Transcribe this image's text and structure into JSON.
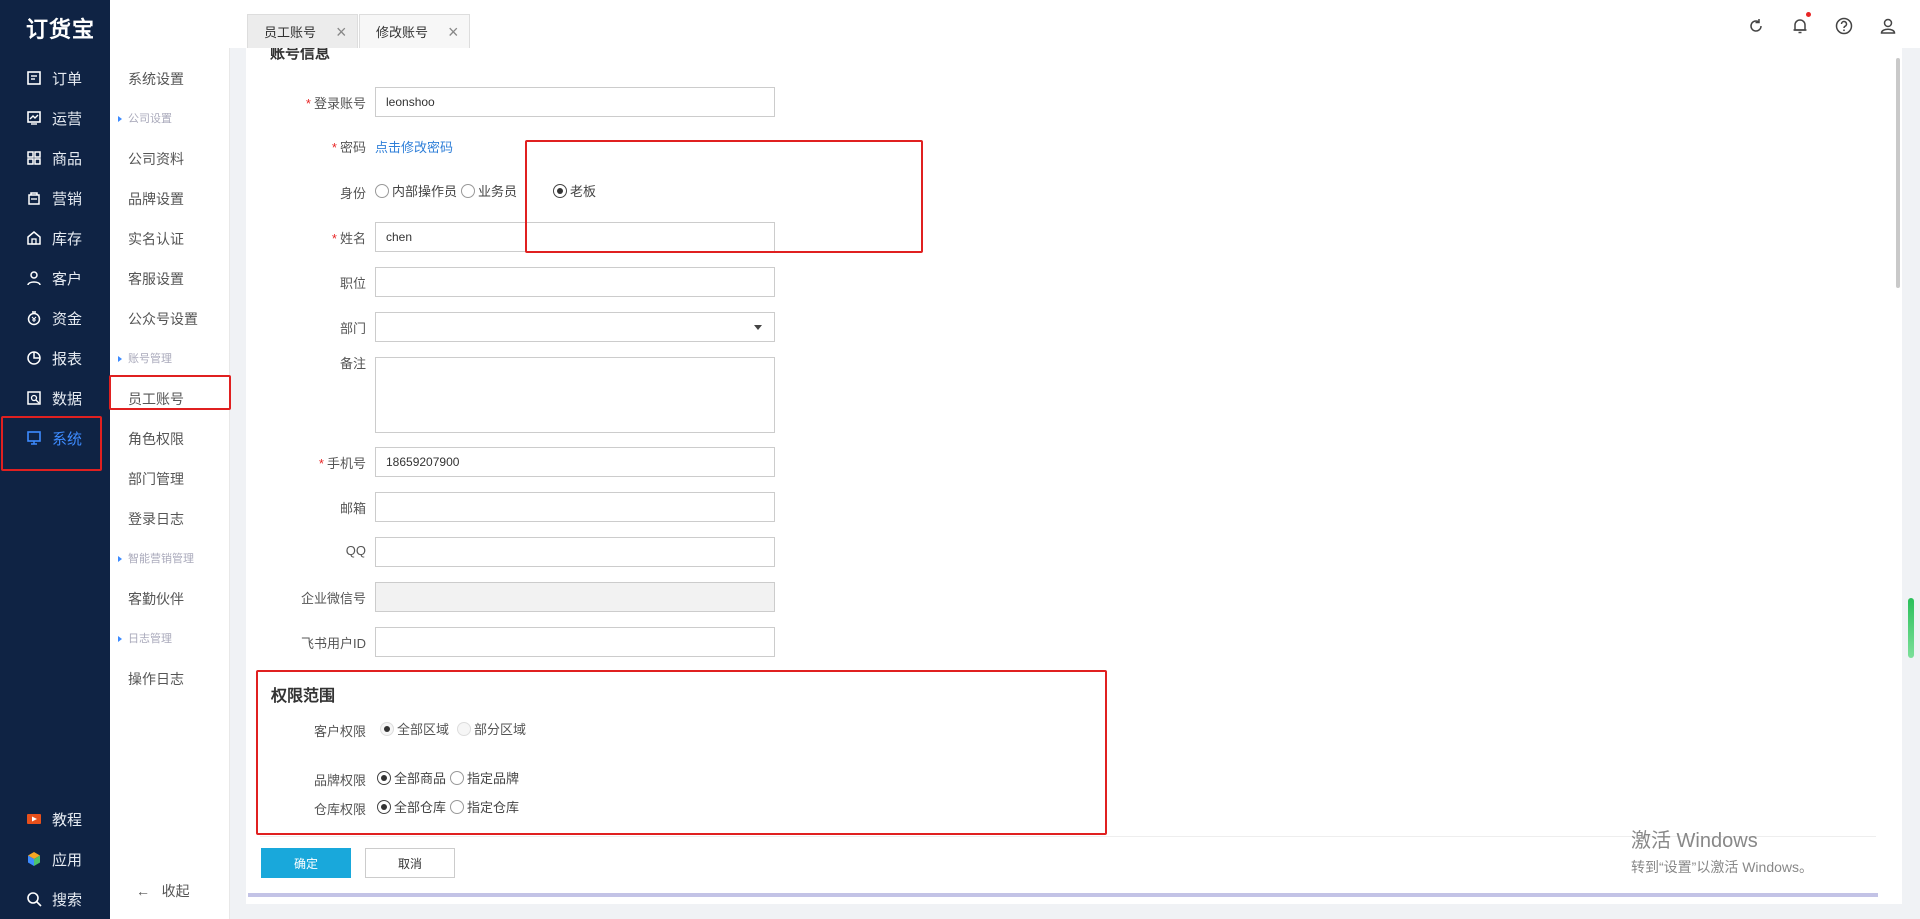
{
  "app": {
    "logo": "订货宝"
  },
  "nav": {
    "items": [
      {
        "label": "订单",
        "icon": "order-icon"
      },
      {
        "label": "运营",
        "icon": "operation-icon"
      },
      {
        "label": "商品",
        "icon": "product-icon"
      },
      {
        "label": "营销",
        "icon": "marketing-icon"
      },
      {
        "label": "库存",
        "icon": "warehouse-icon"
      },
      {
        "label": "客户",
        "icon": "customer-icon"
      },
      {
        "label": "资金",
        "icon": "money-icon"
      },
      {
        "label": "报表",
        "icon": "report-icon"
      },
      {
        "label": "数据",
        "icon": "data-icon"
      },
      {
        "label": "系统",
        "icon": "monitor-icon",
        "active": true
      }
    ],
    "bottom": [
      {
        "label": "教程",
        "icon": "tutorial-icon"
      },
      {
        "label": "应用",
        "icon": "app-icon"
      },
      {
        "label": "搜索",
        "icon": "search-icon"
      }
    ],
    "active_color": "#3d8bff",
    "background": "#0f2344"
  },
  "subnav": {
    "system_settings": "系统设置",
    "group_company": "公司设置",
    "company_info": "公司资料",
    "brand_settings": "品牌设置",
    "real_name": "实名认证",
    "customer_service": "客服设置",
    "official_account": "公众号设置",
    "group_account": "账号管理",
    "staff_account": "员工账号",
    "role_permission": "角色权限",
    "department": "部门管理",
    "login_log": "登录日志",
    "group_marketing": "智能营销管理",
    "partner": "客勤伙伴",
    "group_log": "日志管理",
    "operation_log": "操作日志",
    "collapse": "收起"
  },
  "tabs": [
    {
      "label": "员工账号"
    },
    {
      "label": "修改账号",
      "active": true
    }
  ],
  "form": {
    "section_account": "账号信息",
    "login_account_label": "登录账号",
    "login_account_value": "leonshoo",
    "password_label": "密码",
    "password_link": "点击修改密码",
    "identity_label": "身份",
    "identity_options": [
      "内部操作员",
      "业务员",
      "老板"
    ],
    "identity_selected": "老板",
    "name_label": "姓名",
    "name_value": "chen",
    "position_label": "职位",
    "position_value": "",
    "department_label": "部门",
    "department_value": "",
    "remark_label": "备注",
    "remark_value": "",
    "phone_label": "手机号",
    "phone_value": "18659207900",
    "email_label": "邮箱",
    "email_value": "",
    "qq_label": "QQ",
    "qq_value": "",
    "wechat_label": "企业微信号",
    "wechat_value": "",
    "feishu_label": "飞书用户ID",
    "feishu_value": "",
    "section_permission": "权限范围",
    "customer_perm_label": "客户权限",
    "customer_perm_options": [
      "全部区域",
      "部分区域"
    ],
    "brand_perm_label": "品牌权限",
    "brand_perm_options": [
      "全部商品",
      "指定品牌"
    ],
    "warehouse_perm_label": "仓库权限",
    "warehouse_perm_options": [
      "全部仓库",
      "指定仓库"
    ]
  },
  "buttons": {
    "confirm": "确定",
    "cancel": "取消"
  },
  "watermark": {
    "line1": "激活 Windows",
    "line2": "转到“设置”以激活 Windows。"
  },
  "colors": {
    "highlight_box": "#e02020",
    "primary_button": "#19a8db",
    "link": "#2f7fd8"
  }
}
